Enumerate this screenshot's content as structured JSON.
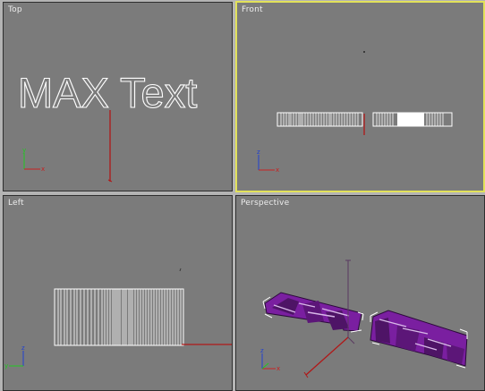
{
  "viewports": {
    "top": {
      "label": "Top",
      "text_object": "MAX Text"
    },
    "front": {
      "label": "Front"
    },
    "left": {
      "label": "Left"
    },
    "perspective": {
      "label": "Perspective"
    }
  },
  "axes": {
    "x": "x",
    "y": "y",
    "z": "z"
  },
  "colors": {
    "viewport_bg": "#7b7b7b",
    "active_border": "#e2e25a",
    "object_white": "#ffffff",
    "object_purple": "#7a1fa0",
    "pivot_red": "#b01818",
    "axis_x": "#c82020",
    "axis_y": "#20c820",
    "axis_z": "#2040d0"
  }
}
